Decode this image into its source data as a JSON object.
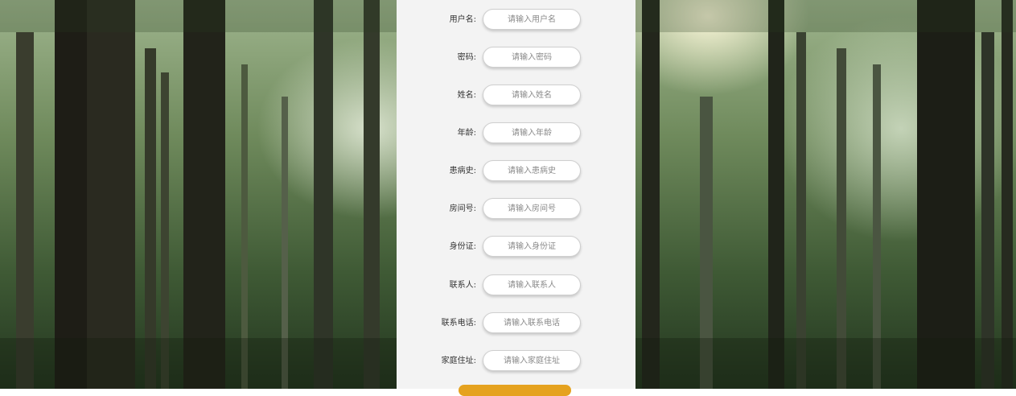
{
  "form": {
    "fields": [
      {
        "label": "用户名:",
        "placeholder": "请输入用户名"
      },
      {
        "label": "密码:",
        "placeholder": "请输入密码"
      },
      {
        "label": "姓名:",
        "placeholder": "请输入姓名"
      },
      {
        "label": "年龄:",
        "placeholder": "请输入年龄"
      },
      {
        "label": "患病史:",
        "placeholder": "请输入患病史"
      },
      {
        "label": "房间号:",
        "placeholder": "请输入房间号"
      },
      {
        "label": "身份证:",
        "placeholder": "请输入身份证"
      },
      {
        "label": "联系人:",
        "placeholder": "请输入联系人"
      },
      {
        "label": "联系电话:",
        "placeholder": "请输入联系电话"
      },
      {
        "label": "家庭住址:",
        "placeholder": "请输入家庭住址"
      }
    ],
    "submit_color": "#e5a21f"
  },
  "background": {
    "description_icon": "forest-background"
  }
}
